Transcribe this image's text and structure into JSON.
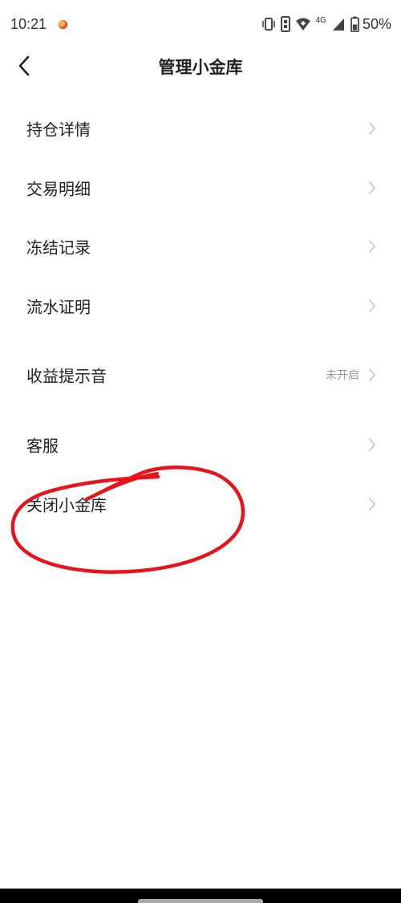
{
  "status_bar": {
    "time": "10:21",
    "network": "4G",
    "battery": "50%",
    "icons": [
      "vibrate-icon",
      "sim-icon",
      "wifi-icon",
      "signal-icon",
      "battery-icon"
    ]
  },
  "header": {
    "title": "管理小金库",
    "back_icon": "chevron-left-icon"
  },
  "menu": {
    "items": [
      {
        "label": "持仓详情"
      },
      {
        "label": "交易明细"
      },
      {
        "label": "冻结记录"
      },
      {
        "label": "流水证明"
      },
      {
        "label": "收益提示音",
        "value": "未开启"
      },
      {
        "label": "客服"
      },
      {
        "label": "关闭小金库"
      }
    ]
  },
  "annotation": {
    "color": "#e8141b",
    "highlighted_item": "关闭小金库"
  },
  "colors": {
    "background": "#ffffff",
    "text": "#222222",
    "secondary_text": "#9a9a9a",
    "chevron": "#c4c4c4"
  }
}
